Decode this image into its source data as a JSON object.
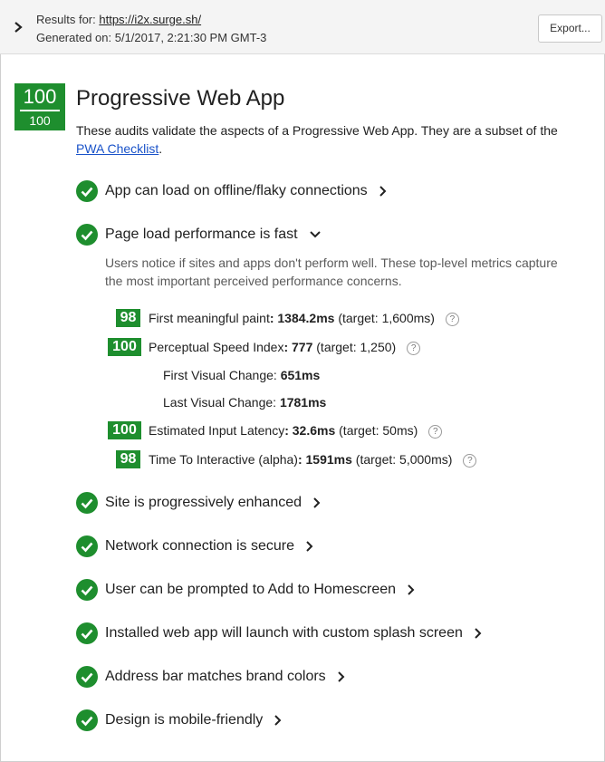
{
  "header": {
    "results_label": "Results for: ",
    "results_url": "https://i2x.surge.sh/",
    "generated": "Generated on: 5/1/2017, 2:21:30 PM GMT-3",
    "export_label": "Export..."
  },
  "category": {
    "score": "100",
    "score_max": "100",
    "title": "Progressive Web App",
    "desc_prefix": "These audits validate the aspects of a Progressive Web App. They are a subset of the ",
    "desc_link": "PWA Checklist",
    "desc_suffix": "."
  },
  "audits": [
    {
      "label": "App can load on offline/flaky connections"
    },
    {
      "label": "Page load performance is fast"
    },
    {
      "label": "Site is progressively enhanced"
    },
    {
      "label": "Network connection is secure"
    },
    {
      "label": "User can be prompted to Add to Homescreen"
    },
    {
      "label": "Installed web app will launch with custom splash screen"
    },
    {
      "label": "Address bar matches brand colors"
    },
    {
      "label": "Design is mobile-friendly"
    }
  ],
  "perf_desc": "Users notice if sites and apps don't perform well. These top-level metrics capture the most important perceived performance concerns.",
  "metrics": [
    {
      "score": "98",
      "name": "First meaningful paint",
      "value": ": 1384.2ms",
      "target": " (target: 1,600ms)"
    },
    {
      "score": "100",
      "name": "Perceptual Speed Index",
      "value": ": 777",
      "target": " (target: 1,250)"
    },
    {
      "score": "100",
      "name": "Estimated Input Latency",
      "value": ": 32.6ms",
      "target": " (target: 50ms)"
    },
    {
      "score": "98",
      "name": "Time To Interactive (alpha)",
      "value": ": 1591ms",
      "target": " (target: 5,000ms)"
    }
  ],
  "submetrics": [
    {
      "name": "First Visual Change: ",
      "value": "651ms"
    },
    {
      "name": "Last Visual Change: ",
      "value": "1781ms"
    }
  ],
  "help_glyph": "?",
  "colors": {
    "pass_green": "#1e8e2e",
    "link_blue": "#1a53c9"
  }
}
